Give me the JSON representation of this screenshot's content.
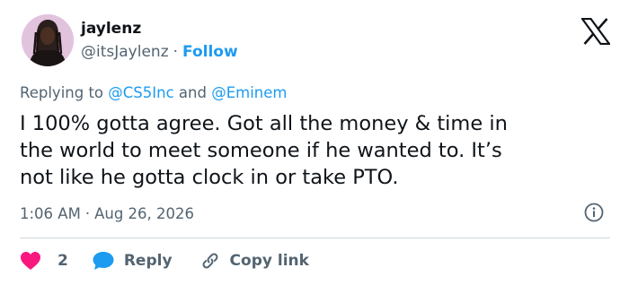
{
  "author": {
    "name": "jaylenz",
    "handle": "@itsJaylenz",
    "separator": "·",
    "follow_label": "Follow"
  },
  "reply_context": {
    "prefix": "Replying to",
    "mention_1": "@CS5Inc",
    "conjunction": "and",
    "mention_2": "@Eminem"
  },
  "tweet": {
    "lines": [
      "I 100% gotta agree. Got all the money & time in",
      "the world to meet someone if he wanted to. It’s",
      "not like he gotta clock in or take PTO."
    ],
    "time": "1:06 AM",
    "separator": "·",
    "date": "Aug 26, 2026"
  },
  "actions": {
    "like_count": "2",
    "reply_label": "Reply",
    "copy_label": "Copy link"
  },
  "icons": {
    "brand": "x-logo-icon",
    "info": "info-icon",
    "like": "heart-icon",
    "reply": "speech-bubble-icon",
    "copy": "link-icon"
  },
  "colors": {
    "text": "#0f1419",
    "secondary_text": "#536471",
    "link": "#1d9bf0",
    "like": "#f91880",
    "reply": "#1d9bf0",
    "divider": "#cfd9de",
    "avatar_bg": "#e2c3de"
  }
}
